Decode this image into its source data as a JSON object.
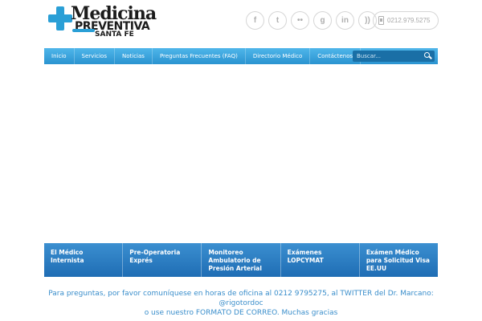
{
  "logo": {
    "line1": "Medicina",
    "line2": "PREVENTIVA",
    "line3": "SANTA FE"
  },
  "social": [
    {
      "icon": "facebook-icon",
      "glyph": "f"
    },
    {
      "icon": "twitter-icon",
      "glyph": "t"
    },
    {
      "icon": "flickr-icon",
      "glyph": "••"
    },
    {
      "icon": "google-icon",
      "glyph": "g"
    },
    {
      "icon": "linkedin-icon",
      "glyph": "in"
    },
    {
      "icon": "rss-icon",
      "glyph": "))"
    }
  ],
  "phone": "0212.979.5275",
  "nav": {
    "items": [
      "Inicio",
      "Servicios",
      "Noticias",
      "Preguntas Frecuentes (FAQ)",
      "Directorio Médico",
      "Contáctenos"
    ],
    "search_placeholder": "Buscar..."
  },
  "features": [
    "El Médico Internista",
    "Pre-Operatoria Exprés",
    "Monitoreo Ambulatorio de Presión Arterial",
    "Exámenes LOPCYMAT",
    "Exámen Médico para Solicitud Visa EE.UU"
  ],
  "note": {
    "line1": "Para preguntas, por favor comuníquese en horas de oficina al 0212 9795275, al TWITTER del Dr. Marcano: @rigotordoc",
    "line2": "o use nuestro FORMATO DE CORREO. Muchas gracias"
  },
  "colors": {
    "accent": "#2a93d0",
    "box": "#1f6db4",
    "note": "#3a8ecb"
  }
}
